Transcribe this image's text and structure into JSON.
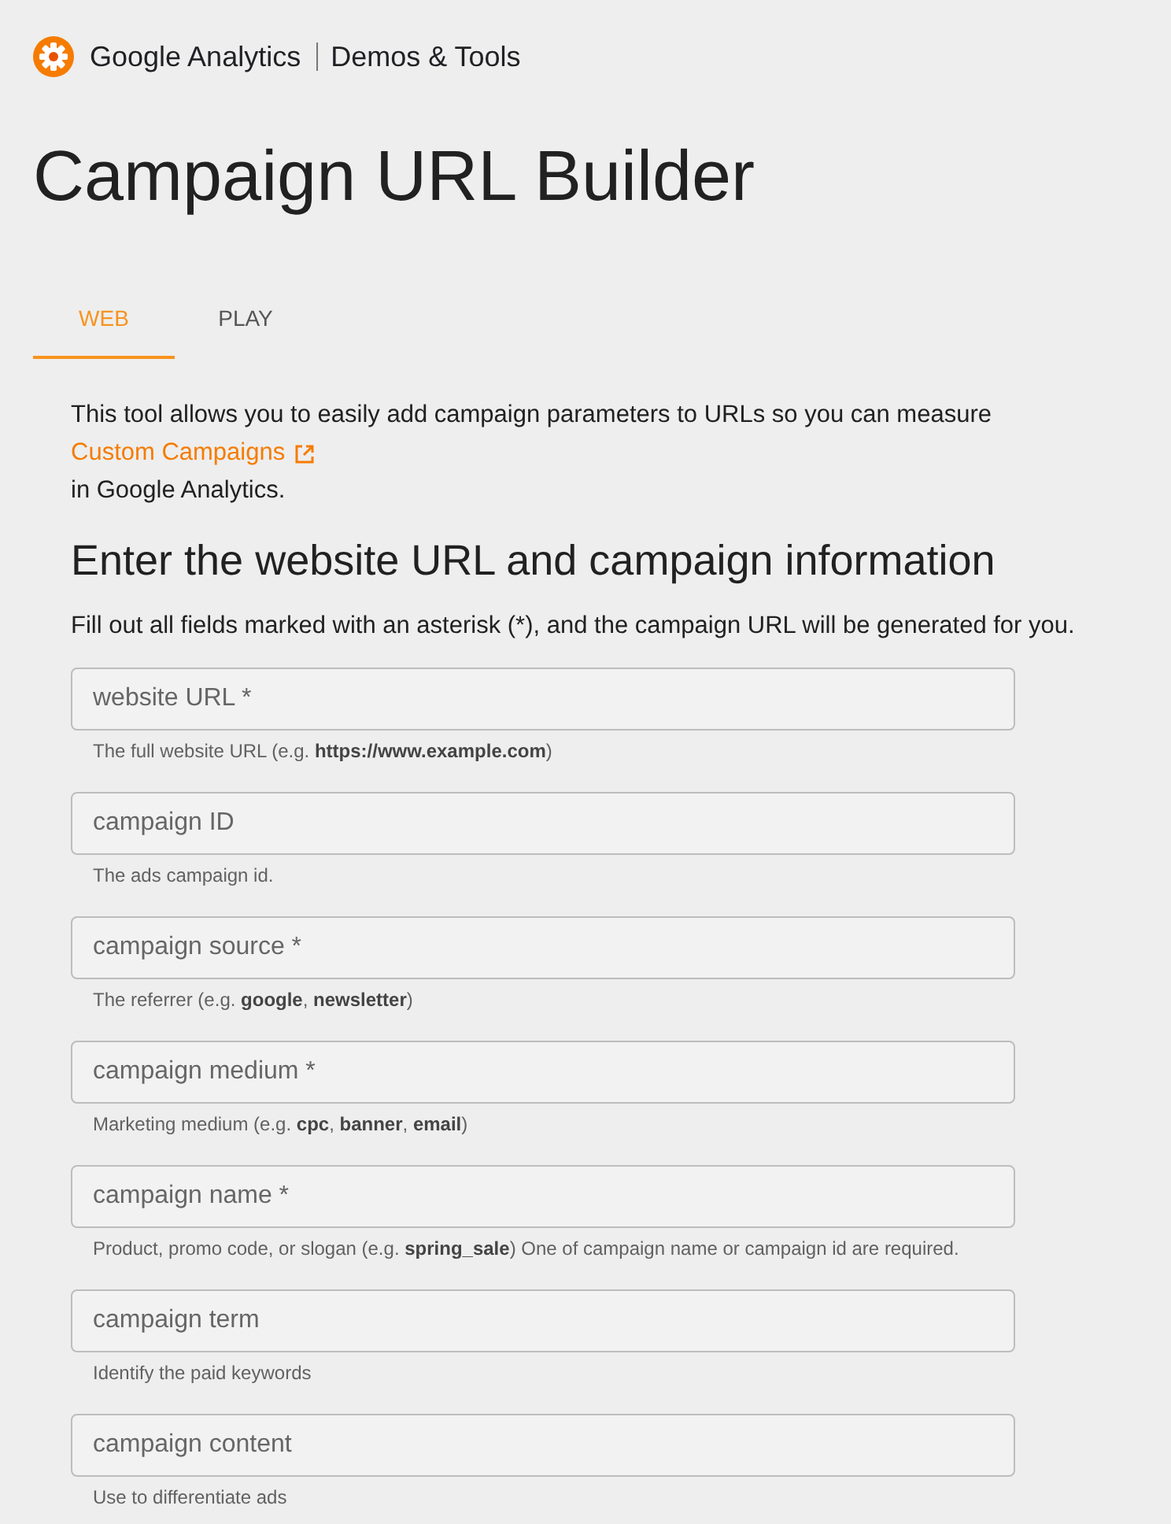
{
  "header": {
    "brand": "Google Analytics",
    "section": "Demos & Tools"
  },
  "title": "Campaign URL Builder",
  "tabs": [
    {
      "label": "WEB",
      "selected": true
    },
    {
      "label": "PLAY",
      "selected": false
    }
  ],
  "intro": {
    "text": "This tool allows you to easily add campaign parameters to URLs so you can measure",
    "link": "Custom Campaigns",
    "after": "in Google Analytics."
  },
  "heading": "Enter the website URL and campaign information",
  "instructions": "Fill out all fields marked with an asterisk (*), and the campaign URL will be generated for you.",
  "fields": [
    {
      "placeholder": "website URL *",
      "helper": "The full website URL (e.g. **https://www.example.com**)"
    },
    {
      "placeholder": "campaign ID",
      "helper": "The ads campaign id."
    },
    {
      "placeholder": "campaign source *",
      "helper": "The referrer (e.g. **google**, **newsletter**)"
    },
    {
      "placeholder": "campaign medium *",
      "helper": "Marketing medium (e.g. **cpc**, **banner**, **email**)"
    },
    {
      "placeholder": "campaign name *",
      "helper": "Product, promo code, or slogan (e.g. **spring_sale**) One of campaign name or campaign id are required."
    },
    {
      "placeholder": "campaign term",
      "helper": "Identify the paid keywords"
    },
    {
      "placeholder": "campaign content",
      "helper": "Use to differentiate ads"
    }
  ]
}
